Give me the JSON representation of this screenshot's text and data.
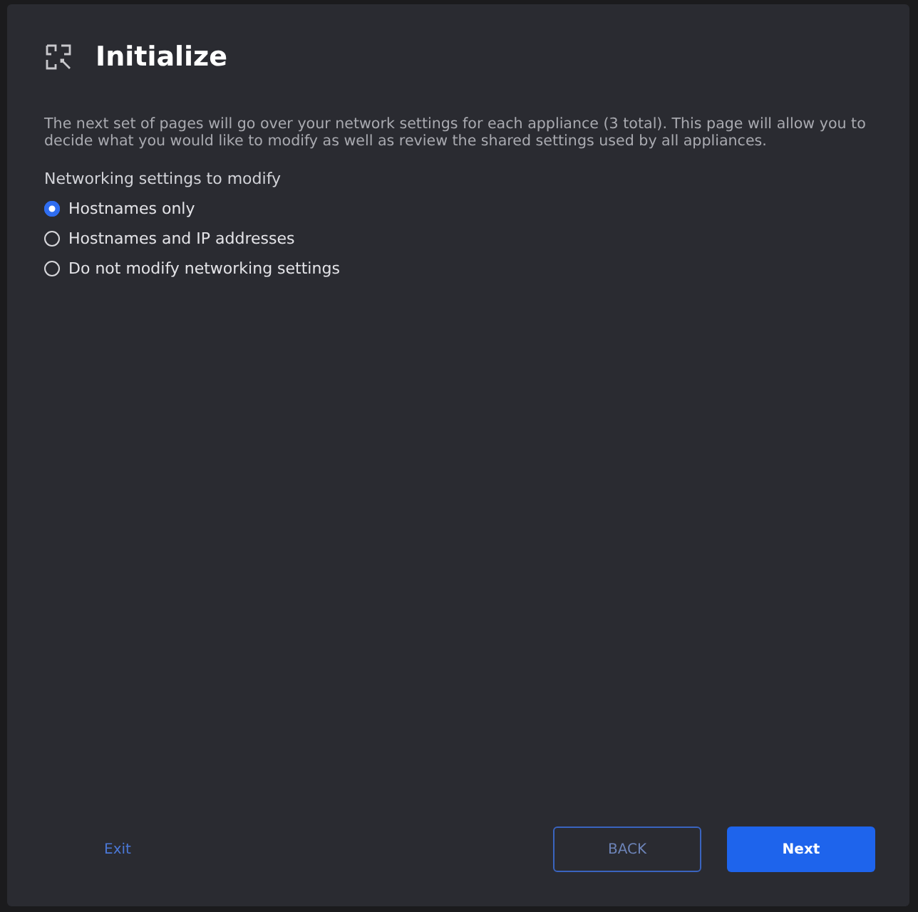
{
  "dialog": {
    "title": "Initialize",
    "description": "The next set of pages will go over your network settings for each appliance (3 total). This page will allow you to decide what you would like to modify as well as review the shared settings used by all appliances.",
    "group_label": "Networking settings to modify",
    "options": [
      {
        "label": "Hostnames only",
        "selected": true
      },
      {
        "label": "Hostnames and IP addresses",
        "selected": false
      },
      {
        "label": "Do not modify networking settings",
        "selected": false
      }
    ],
    "exit": "Exit",
    "back": "BACK",
    "next": "Next"
  }
}
